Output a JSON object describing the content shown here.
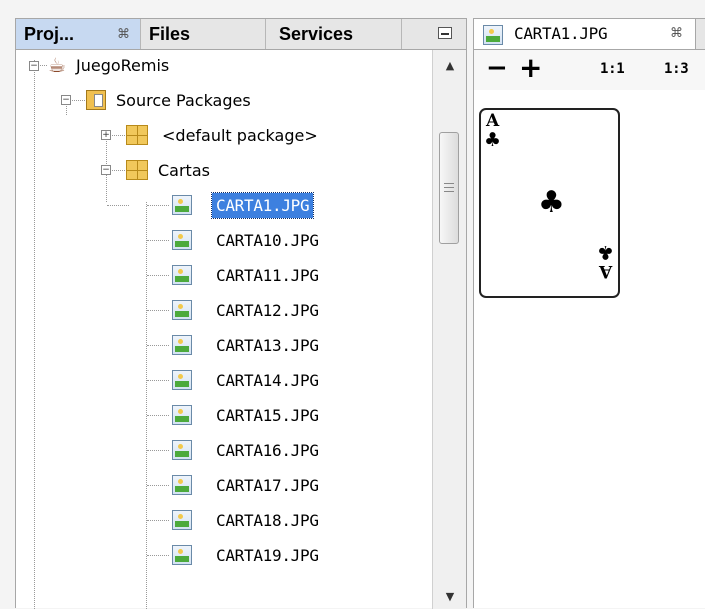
{
  "left_panel": {
    "tabs": [
      {
        "label": "Proj...",
        "close": "⌘"
      },
      {
        "label": "Files"
      },
      {
        "label": "Services"
      }
    ]
  },
  "tree": [
    {
      "label": "JuegoRemis",
      "icon": "coffee-cup-icon"
    },
    {
      "label": "Source Packages",
      "icon": "source-folder-icon"
    },
    {
      "label": "<default package>",
      "icon": "package-icon"
    },
    {
      "label": "Cartas",
      "icon": "package-icon"
    },
    {
      "label": "CARTA1.JPG",
      "icon": "image-file-icon",
      "selected": true
    },
    {
      "label": "CARTA10.JPG",
      "icon": "image-file-icon"
    },
    {
      "label": "CARTA11.JPG",
      "icon": "image-file-icon"
    },
    {
      "label": "CARTA12.JPG",
      "icon": "image-file-icon"
    },
    {
      "label": "CARTA13.JPG",
      "icon": "image-file-icon"
    },
    {
      "label": "CARTA14.JPG",
      "icon": "image-file-icon"
    },
    {
      "label": "CARTA15.JPG",
      "icon": "image-file-icon"
    },
    {
      "label": "CARTA16.JPG",
      "icon": "image-file-icon"
    },
    {
      "label": "CARTA17.JPG",
      "icon": "image-file-icon"
    },
    {
      "label": "CARTA18.JPG",
      "icon": "image-file-icon"
    },
    {
      "label": "CARTA19.JPG",
      "icon": "image-file-icon"
    }
  ],
  "editor": {
    "tab_label": "CARTA1.JPG",
    "tab_close": "⌘",
    "toolbar": {
      "zoom_out": "−",
      "zoom_in": "+",
      "zoom_1_1": "1:1",
      "zoom_1_3": "1:3"
    }
  },
  "card": {
    "rank": "A",
    "suit": "♣"
  },
  "colors": {
    "selection": "#3d80df",
    "active_tab": "#c7d9f1",
    "tabbar": "#e6e6e6"
  }
}
